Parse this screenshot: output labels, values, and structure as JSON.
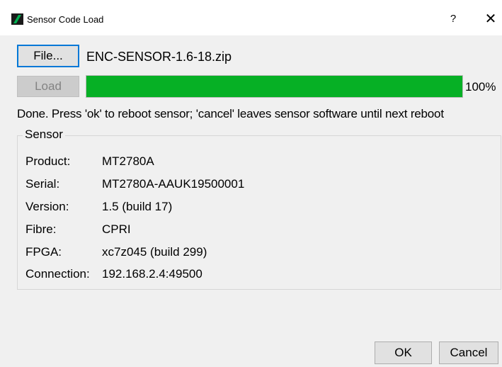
{
  "window": {
    "title": "Sensor Code Load",
    "help_label": "?",
    "close_label": "✕",
    "icon": "app-logo-icon",
    "accent": "#0078d7"
  },
  "file": {
    "button_label": "File...",
    "name": "ENC-SENSOR-1.6-18.zip"
  },
  "load": {
    "button_label": "Load",
    "progress_fraction": 1.0,
    "progress_text": "100%",
    "progress_color": "#06b025"
  },
  "status_text": "Done. Press 'ok' to reboot sensor; 'cancel' leaves sensor software until next reboot",
  "sensor": {
    "group_title": "Sensor",
    "rows": [
      {
        "label": "Product:",
        "value": "MT2780A"
      },
      {
        "label": "Serial:",
        "value": "MT2780A-AAUK19500001"
      },
      {
        "label": "Version:",
        "value": "1.5 (build 17)"
      },
      {
        "label": "Fibre:",
        "value": "CPRI"
      },
      {
        "label": "FPGA:",
        "value": "xc7z045 (build 299)"
      },
      {
        "label": "Connection:",
        "value": "192.168.2.4:49500"
      }
    ]
  },
  "footer": {
    "ok_label": "OK",
    "cancel_label": "Cancel"
  }
}
